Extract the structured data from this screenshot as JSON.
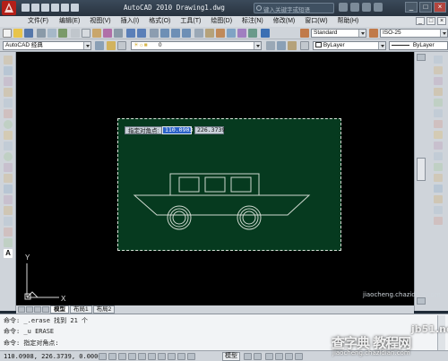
{
  "window": {
    "title": "AutoCAD 2010  Drawing1.dwg",
    "search_placeholder": "键入关键字或短语",
    "controls": [
      "_",
      "□",
      "×"
    ]
  },
  "menu": {
    "items": [
      "文件(F)",
      "编辑(E)",
      "视图(V)",
      "插入(I)",
      "格式(O)",
      "工具(T)",
      "绘图(D)",
      "标注(N)",
      "修改(M)",
      "窗口(W)",
      "帮助(H)"
    ]
  },
  "toolbar": {
    "text_style": "Standard",
    "dim_style": "ISO-25",
    "workspace": "AutoCAD 经典",
    "layer": "0",
    "color": "ByLayer",
    "linetype": "ByLayer"
  },
  "canvas": {
    "prompt_label": "指定对角点:",
    "coord_x": "110.0903",
    "coord_y": "226.3739",
    "ucs_x": "X",
    "ucs_y": "Y"
  },
  "tabs": [
    "模型",
    "布局1",
    "布局2"
  ],
  "command": {
    "line1": "命令: _.erase 找到 21 个",
    "line2": "命令: _u ERASE",
    "line3": "命令: 指定对角点:"
  },
  "status": {
    "coords": "110.0908, 226.3739, 0.0000",
    "mode": "模型"
  },
  "watermark": {
    "site": "jb51.net",
    "brand": "查字典 教程网",
    "url": "jiaocheng.chazidian.com",
    "small": "jiaocheng.chazidian.com"
  },
  "colors": {
    "canvas_bg": "#000000",
    "selection_fill": "#063a1f",
    "titlebar": "#2f3b48",
    "accent": "#d8241d"
  }
}
